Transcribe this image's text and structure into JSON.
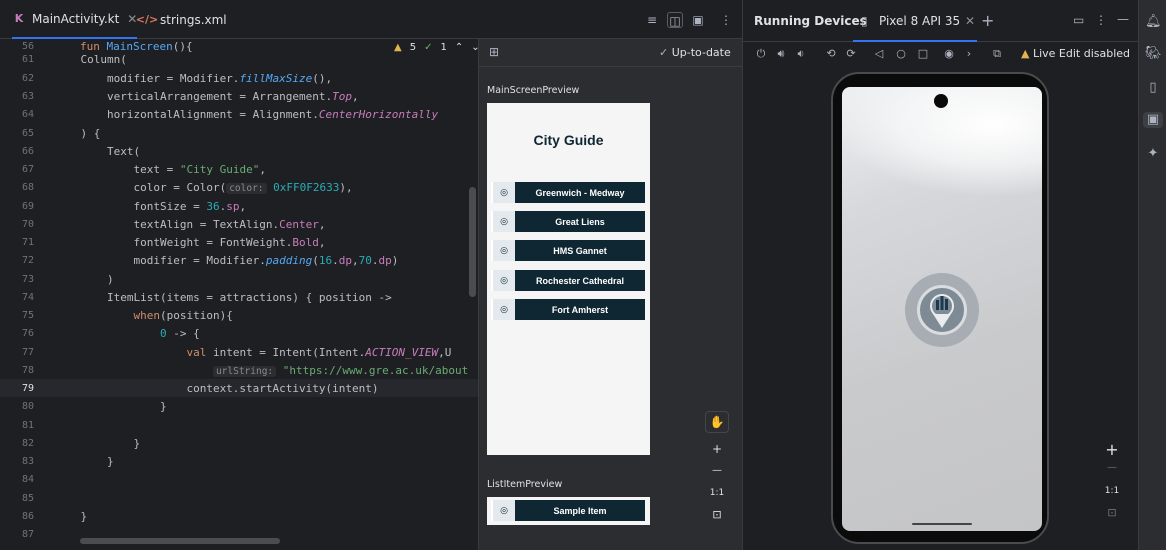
{
  "editor": {
    "tabs": [
      {
        "label": "MainActivity.kt",
        "active": true
      },
      {
        "label": "strings.xml",
        "active": false
      }
    ],
    "inspection": {
      "warnings": "5",
      "checks": "1"
    },
    "lines": [
      {
        "n": "56",
        "segs": [
          [
            "kw",
            "fun "
          ],
          [
            "fn",
            "MainScreen"
          ],
          [
            "",
            "(){"
          ]
        ]
      },
      {
        "n": "61",
        "segs": [
          [
            "",
            "    Column("
          ]
        ]
      },
      {
        "n": "62",
        "segs": [
          [
            "",
            "        modifier = Modifier."
          ],
          [
            "fn it",
            "fillMaxSize"
          ],
          [
            "",
            "(),"
          ]
        ]
      },
      {
        "n": "63",
        "segs": [
          [
            "",
            "        verticalArrangement = Arrangement."
          ],
          [
            "prop it",
            "Top"
          ],
          [
            "",
            ","
          ]
        ]
      },
      {
        "n": "64",
        "segs": [
          [
            "",
            "        horizontalAlignment = Alignment."
          ],
          [
            "prop it",
            "CenterHorizontally"
          ]
        ]
      },
      {
        "n": "65",
        "segs": [
          [
            "",
            "    ) {"
          ]
        ]
      },
      {
        "n": "66",
        "segs": [
          [
            "",
            "        Text("
          ]
        ]
      },
      {
        "n": "67",
        "segs": [
          [
            "",
            "            text = "
          ],
          [
            "str",
            "\"City Guide\""
          ],
          [
            "",
            ","
          ]
        ]
      },
      {
        "n": "68",
        "segs": [
          [
            "",
            "            color = Color("
          ],
          [
            "hint",
            "color:"
          ],
          [
            "",
            " "
          ],
          [
            "num",
            "0xFF0F2633"
          ],
          [
            "",
            "),"
          ]
        ]
      },
      {
        "n": "69",
        "segs": [
          [
            "",
            "            fontSize = "
          ],
          [
            "num",
            "36"
          ],
          [
            "",
            "."
          ],
          [
            "prop",
            "sp"
          ],
          [
            "",
            ","
          ]
        ]
      },
      {
        "n": "70",
        "segs": [
          [
            "",
            "            textAlign = TextAlign."
          ],
          [
            "prop",
            "Center"
          ],
          [
            "",
            ","
          ]
        ]
      },
      {
        "n": "71",
        "segs": [
          [
            "",
            "            fontWeight = FontWeight."
          ],
          [
            "prop",
            "Bold"
          ],
          [
            "",
            ","
          ]
        ]
      },
      {
        "n": "72",
        "segs": [
          [
            "",
            "            modifier = Modifier."
          ],
          [
            "fn it",
            "padding"
          ],
          [
            "",
            "("
          ],
          [
            "num",
            "16"
          ],
          [
            "",
            "."
          ],
          [
            "prop",
            "dp"
          ],
          [
            "",
            ","
          ],
          [
            "num",
            "70"
          ],
          [
            "",
            "."
          ],
          [
            "prop",
            "dp"
          ],
          [
            "",
            ")"
          ]
        ]
      },
      {
        "n": "73",
        "segs": [
          [
            "",
            "        )"
          ]
        ]
      },
      {
        "n": "74",
        "segs": [
          [
            "",
            "        ItemList(items = attractions) { position ->"
          ]
        ]
      },
      {
        "n": "75",
        "segs": [
          [
            "",
            "            "
          ],
          [
            "kw",
            "when"
          ],
          [
            "",
            "(position){"
          ]
        ]
      },
      {
        "n": "76",
        "segs": [
          [
            "",
            "                "
          ],
          [
            "num",
            "0"
          ],
          [
            "",
            " -> {"
          ]
        ]
      },
      {
        "n": "77",
        "segs": [
          [
            "",
            "                    "
          ],
          [
            "kw",
            "val "
          ],
          [
            "",
            "intent = Intent(Intent."
          ],
          [
            "prop it",
            "ACTION_VIEW"
          ],
          [
            "",
            ",U"
          ]
        ]
      },
      {
        "n": "78",
        "segs": [
          [
            "",
            "                        "
          ],
          [
            "hint",
            "urlString:"
          ],
          [
            "",
            " "
          ],
          [
            "str",
            "\"https://www.gre.ac.uk/about"
          ]
        ]
      },
      {
        "n": "79",
        "segs": [
          [
            "",
            "                    context.startActivity(intent)"
          ]
        ]
      },
      {
        "n": "80",
        "segs": [
          [
            "",
            "                }"
          ]
        ]
      },
      {
        "n": "81",
        "segs": [
          [
            "",
            ""
          ]
        ]
      },
      {
        "n": "82",
        "segs": [
          [
            "",
            "            }"
          ]
        ]
      },
      {
        "n": "83",
        "segs": [
          [
            "",
            "        }"
          ]
        ]
      },
      {
        "n": "84",
        "segs": [
          [
            "",
            ""
          ]
        ]
      },
      {
        "n": "85",
        "segs": [
          [
            "",
            ""
          ]
        ]
      },
      {
        "n": "86",
        "segs": [
          [
            "",
            "    }"
          ]
        ]
      },
      {
        "n": "87",
        "segs": [
          [
            "",
            ""
          ]
        ]
      }
    ],
    "current_line": "79"
  },
  "preview": {
    "status": "Up-to-date",
    "main_label": "MainScreenPreview",
    "title": "City Guide",
    "items": [
      "Greenwich - Medway",
      "Great Liens",
      "HMS Gannet",
      "Rochester Cathedral",
      "Fort Amherst"
    ],
    "list_label": "ListItemPreview",
    "sample_item": "Sample Item",
    "zoom": {
      "plus": "+",
      "minus": "—",
      "ratio": "1:1"
    }
  },
  "devices": {
    "title": "Running Devices",
    "device_tab": "Pixel 8 API 35",
    "live_edit": "Live Edit disabled",
    "zoom": {
      "plus": "+",
      "minus": "—",
      "ratio": "1:1"
    }
  },
  "colors": {
    "accent": "#3574f0",
    "brand": "#0F2633"
  }
}
